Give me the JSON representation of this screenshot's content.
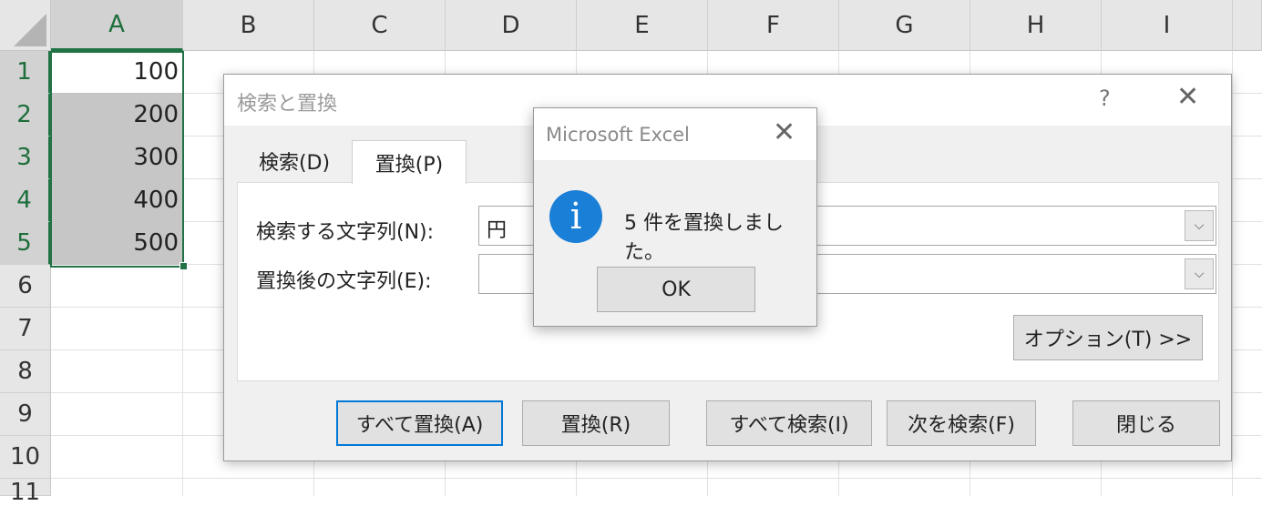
{
  "spreadsheet": {
    "columns": [
      "A",
      "B",
      "C",
      "D",
      "E",
      "F",
      "G",
      "H",
      "I"
    ],
    "rows": [
      "1",
      "2",
      "3",
      "4",
      "5",
      "6",
      "7",
      "8",
      "9",
      "10",
      "11"
    ],
    "cells": [
      "100",
      "200",
      "300",
      "400",
      "500"
    ]
  },
  "dialog": {
    "title": "検索と置換",
    "help_label": "?",
    "close_label": "✕",
    "tabs": {
      "find": "検索(D)",
      "replace": "置換(P)"
    },
    "find_label": "検索する文字列(N):",
    "find_value": "円",
    "replace_label": "置換後の文字列(E):",
    "replace_value": "",
    "dropdown_glyph": "⌵",
    "options_button": "オプション(T) >>",
    "buttons": {
      "replace_all": "すべて置換(A)",
      "replace": "置換(R)",
      "find_all": "すべて検索(I)",
      "find_next": "次を検索(F)",
      "close": "閉じる"
    }
  },
  "message_box": {
    "title": "Microsoft Excel",
    "close_label": "✕",
    "icon": "info-icon",
    "icon_glyph": "i",
    "text": "5 件を置換しました。",
    "ok_button": "OK"
  },
  "colors": {
    "selection_green": "#217346",
    "info_blue": "#1a7fd6",
    "default_button_border": "#0078d7"
  }
}
